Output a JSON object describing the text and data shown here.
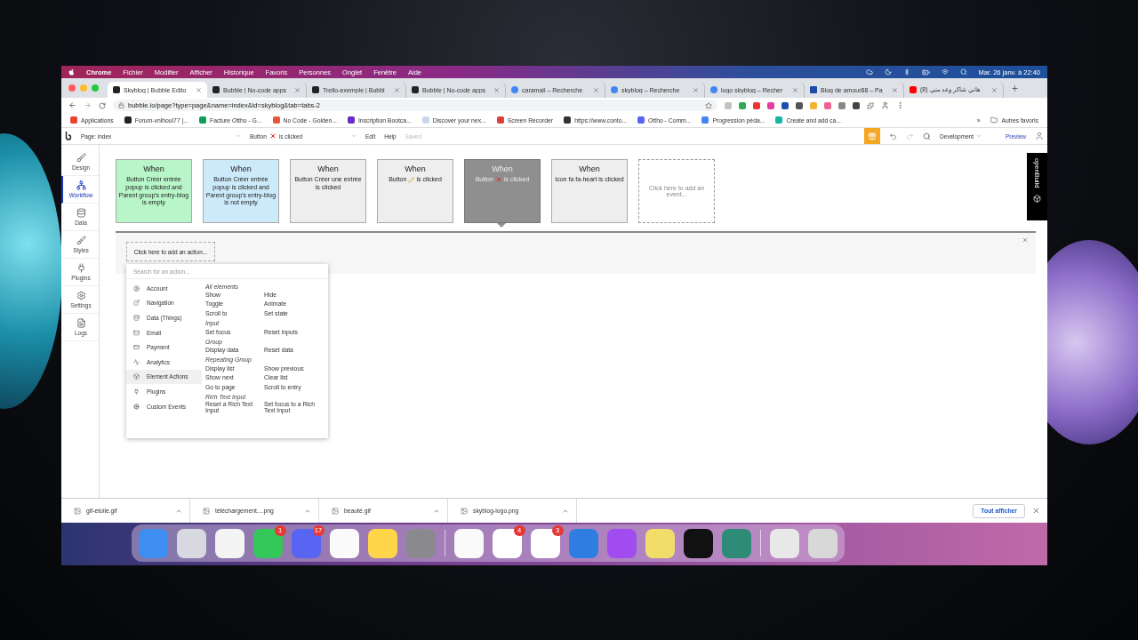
{
  "menu_bar": {
    "app": "Chrome",
    "items": [
      "Fichier",
      "Modifier",
      "Afficher",
      "Historique",
      "Favoris",
      "Personnes",
      "Onglet",
      "Fenêtre",
      "Aide"
    ],
    "clock": "Mar. 26 janv. à 22:40"
  },
  "tabs": [
    {
      "title": "Skyblog | Bubble Edito",
      "kind": "bubble",
      "selected": true
    },
    {
      "title": "Bubble | No-code apps",
      "kind": "bubble",
      "selected": false
    },
    {
      "title": "Trello-exemple | Bubbl",
      "kind": "bubble",
      "selected": false
    },
    {
      "title": "Bubble | No-code apps",
      "kind": "bubble",
      "selected": false
    },
    {
      "title": "caramail – Recherche",
      "kind": "google",
      "selected": false
    },
    {
      "title": "skyblog – Recherche",
      "kind": "google",
      "selected": false
    },
    {
      "title": "logo skyblog – Recher",
      "kind": "google",
      "selected": false
    },
    {
      "title": "Blog de amour88 – Pa",
      "kind": "star",
      "selected": false
    },
    {
      "title": "(8) هاني شاكر وعد مني",
      "kind": "video",
      "selected": false
    }
  ],
  "url": "bubble.io/page?type=page&name=index&id=skyblog&tab=tabs-2",
  "bookmarks": [
    {
      "label": "Applications",
      "color": "#e94235"
    },
    {
      "label": "Forum-vnlhoul77 |...",
      "color": "#222222"
    },
    {
      "label": "Facture Ottho - G...",
      "color": "#0f9d58"
    },
    {
      "label": "No Code - Golden...",
      "color": "#e8553a"
    },
    {
      "label": "Inscription Bootca...",
      "color": "#6a2cc8"
    },
    {
      "label": "Discover your nex...",
      "color": "#c9d8ea"
    },
    {
      "label": "Screen Recorder",
      "color": "#e03c3c"
    },
    {
      "label": "https://www.conto...",
      "color": "#333333"
    },
    {
      "label": "Ottho - Comm...",
      "color": "#5865f2"
    },
    {
      "label": "Progression péda...",
      "color": "#4285f4"
    },
    {
      "label": "Create and add ca...",
      "color": "#12b5a8"
    }
  ],
  "bookmarks_more": "»",
  "other_bookmarks": "Autres favoris",
  "editor_bar": {
    "page": "Page: index",
    "event_text": "Button",
    "event_after": "is clicked",
    "edit": "Edit",
    "help": "Help",
    "status": "Saved",
    "environment": "Development",
    "preview": "Preview"
  },
  "sidebar": [
    {
      "label": "Design",
      "selected": false
    },
    {
      "label": "Workflow",
      "selected": true
    },
    {
      "label": "Data",
      "selected": false
    },
    {
      "label": "Styles",
      "selected": false
    },
    {
      "label": "Plugins",
      "selected": false
    },
    {
      "label": "Settings",
      "selected": false
    },
    {
      "label": "Logs",
      "selected": false
    }
  ],
  "events": [
    {
      "title": "When",
      "text": "Button Créer entrée popup is clicked and Parent group's entry-blog is empty",
      "kind": "plain",
      "color": "#b8f5c8",
      "selected": false
    },
    {
      "title": "When",
      "text": "Button Créer entrée popup is clicked and Parent group's entry-blog is not empty",
      "kind": "plain",
      "color": "#cdeafb",
      "selected": false
    },
    {
      "title": "When",
      "text": "Button Créer une entrée is clicked",
      "kind": "plain",
      "color": "#eeeeee",
      "selected": false
    },
    {
      "title": "When",
      "text": "Button",
      "kind": "pencil",
      "text_after": "is clicked",
      "color": "#eeeeee",
      "selected": false
    },
    {
      "title": "When",
      "text": "Button",
      "kind": "cross",
      "text_after": "is clicked",
      "color": "#8f8f8f",
      "selected": true
    },
    {
      "title": "When",
      "text": "Icon fa fa-heart is clicked",
      "kind": "plain",
      "color": "#eeeeee",
      "selected": false
    }
  ],
  "add_event": "Click here to add an event...",
  "add_action": "Click here to add an action...",
  "action_menu": {
    "search_placeholder": "Search for an action...",
    "categories": [
      {
        "label": "Account",
        "selected": false
      },
      {
        "label": "Navigation",
        "selected": false
      },
      {
        "label": "Data (Things)",
        "selected": false
      },
      {
        "label": "Email",
        "selected": false
      },
      {
        "label": "Payment",
        "selected": false
      },
      {
        "label": "Analytics",
        "selected": false
      },
      {
        "label": "Element Actions",
        "selected": true
      },
      {
        "label": "Plugins",
        "selected": false
      },
      {
        "label": "Custom Events",
        "selected": false
      }
    ],
    "sections": [
      {
        "title": "All elements",
        "actions": [
          "Show",
          "Hide",
          "Toggle",
          "Animate",
          "Scroll to",
          "Set state"
        ]
      },
      {
        "title": "Input",
        "actions": [
          "Set focus",
          "Reset inputs"
        ]
      },
      {
        "title": "Group",
        "actions": [
          "Display data",
          "Reset data"
        ]
      },
      {
        "title": "Repeating Group",
        "actions": [
          "Display list",
          "Show previous",
          "Show next",
          "Clear list",
          "Go to page",
          "Scroll to entry"
        ]
      },
      {
        "title": "Rich Text Input",
        "actions": [
          "Reset a Rich Text Input",
          "Set focus to a Rich Text Input"
        ]
      }
    ]
  },
  "side_tab": "openBuild",
  "downloads": [
    "gif-etoile.gif",
    "téléchargement....png",
    "beauté.gif",
    "skyblog-logo.png"
  ],
  "show_all": "Tout afficher",
  "dock": [
    {
      "kind": "finder"
    },
    {
      "kind": "launchpad"
    },
    {
      "kind": "chrome"
    },
    {
      "kind": "messages",
      "badge": "1"
    },
    {
      "kind": "discord",
      "badge": "17"
    },
    {
      "kind": "reminders"
    },
    {
      "kind": "notes"
    },
    {
      "kind": "settings"
    },
    {
      "kind": "separator"
    },
    {
      "kind": "pen"
    },
    {
      "kind": "notion",
      "badge": "4"
    },
    {
      "kind": "slack",
      "badge": "3"
    },
    {
      "kind": "spark"
    },
    {
      "kind": "messenger"
    },
    {
      "kind": "stickies"
    },
    {
      "kind": "circle"
    },
    {
      "kind": "robot"
    },
    {
      "kind": "separator"
    },
    {
      "kind": "document"
    },
    {
      "kind": "trash"
    }
  ]
}
